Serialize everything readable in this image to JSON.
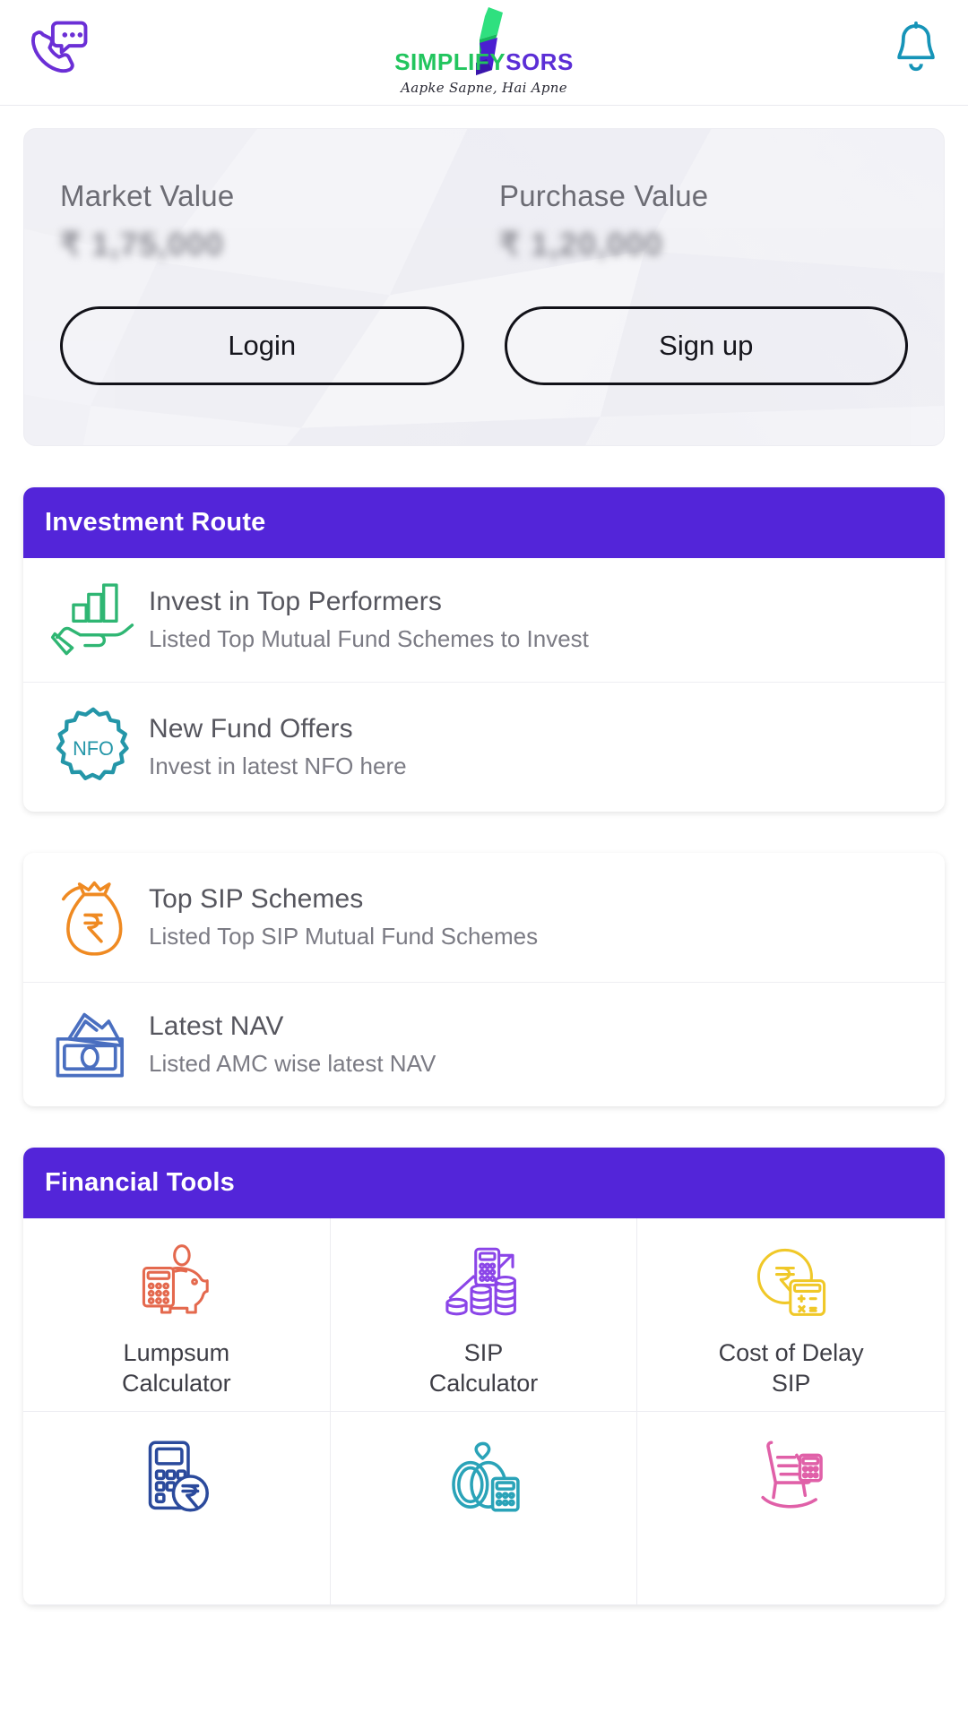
{
  "header": {
    "support_icon": "phone-chat-icon",
    "notification_icon": "bell-icon",
    "brand_name_part1": "SIMPLIFY",
    "brand_name_part2": "SORS",
    "tagline": "Aapke Sapne, Hai Apne",
    "brand_green": "#22c55e",
    "brand_purple": "#5b2ed6"
  },
  "hero": {
    "market_value_label": "Market Value",
    "market_value": "₹ 1,75,000",
    "purchase_value_label": "Purchase Value",
    "purchase_value": "₹ 1,20,000",
    "login_label": "Login",
    "signup_label": "Sign up"
  },
  "investment_route": {
    "title": "Investment Route",
    "accent": "#5325d9",
    "items": [
      {
        "icon": "hand-bar-chart-icon",
        "icon_color": "#2fb673",
        "title": "Invest in Top Performers",
        "subtitle": "Listed Top Mutual Fund Schemes to Invest"
      },
      {
        "icon": "nfo-badge-icon",
        "icon_color": "#2496a8",
        "title": "New Fund Offers",
        "subtitle": "Invest in latest NFO here"
      }
    ]
  },
  "secondary_routes": {
    "items": [
      {
        "icon": "money-bag-rupee-icon",
        "icon_color": "#ef8a22",
        "title": "Top SIP Schemes",
        "subtitle": "Listed Top SIP Mutual Fund Schemes"
      },
      {
        "icon": "banknotes-icon",
        "icon_color": "#4a6fc0",
        "title": "Latest NAV",
        "subtitle": "Listed AMC wise latest NAV"
      }
    ]
  },
  "financial_tools": {
    "title": "Financial Tools",
    "accent": "#5325d9",
    "items": [
      {
        "icon": "piggy-bank-calculator-icon",
        "icon_color": "#e4694e",
        "label_line1": "Lumpsum",
        "label_line2": "Calculator"
      },
      {
        "icon": "calculator-coins-growth-icon",
        "icon_color": "#8b45e8",
        "label_line1": "SIP",
        "label_line2": "Calculator"
      },
      {
        "icon": "rupee-coin-calculator-icon",
        "icon_color": "#f0c828",
        "label_line1": "Cost of Delay",
        "label_line2": "SIP"
      },
      {
        "icon": "calculator-rupee-coin-icon",
        "icon_color": "#2b4a9c",
        "label_line1": "",
        "label_line2": ""
      },
      {
        "icon": "wedding-rings-calculator-icon",
        "icon_color": "#2aa3b8",
        "label_line1": "",
        "label_line2": ""
      },
      {
        "icon": "rocking-chair-icon",
        "icon_color": "#e060a8",
        "label_line1": "",
        "label_line2": ""
      }
    ]
  }
}
